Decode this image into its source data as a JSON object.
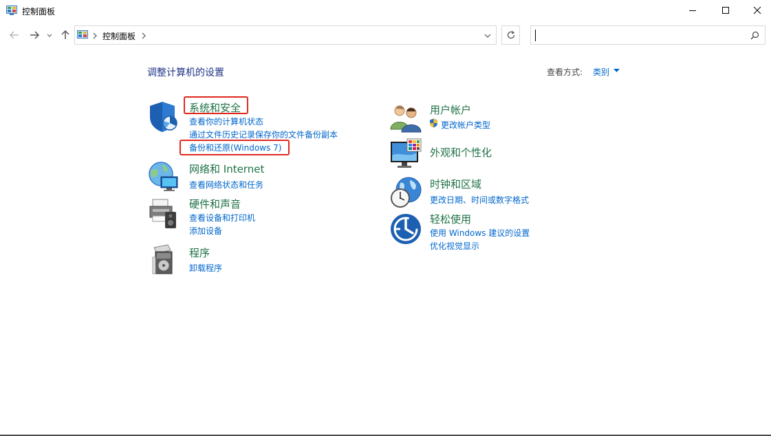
{
  "window": {
    "title": "控制面板"
  },
  "addressbar": {
    "breadcrumb": "控制面板",
    "search_value": ""
  },
  "page": {
    "title": "调整计算机的设置",
    "view_by_label": "查看方式:",
    "view_by_value": "类别"
  },
  "categories": [
    {
      "title": "系统和安全",
      "links": [
        "查看你的计算机状态",
        "通过文件历史记录保存你的文件备份副本",
        "备份和还原(Windows 7)"
      ]
    },
    {
      "title": "网络和 Internet",
      "links": [
        "查看网络状态和任务"
      ]
    },
    {
      "title": "硬件和声音",
      "links": [
        "查看设备和打印机",
        "添加设备"
      ]
    },
    {
      "title": "程序",
      "links": [
        "卸载程序"
      ]
    },
    {
      "title": "用户帐户",
      "links": [
        "更改帐户类型"
      ]
    },
    {
      "title": "外观和个性化",
      "links": []
    },
    {
      "title": "时钟和区域",
      "links": [
        "更改日期、时间或数字格式"
      ]
    },
    {
      "title": "轻松使用",
      "links": [
        "使用 Windows 建议的设置",
        "优化视觉显示"
      ]
    }
  ],
  "colors": {
    "category_title": "#1e7145",
    "link": "#0066cc",
    "highlight_box": "#e0281e",
    "page_title": "#1e3287"
  }
}
